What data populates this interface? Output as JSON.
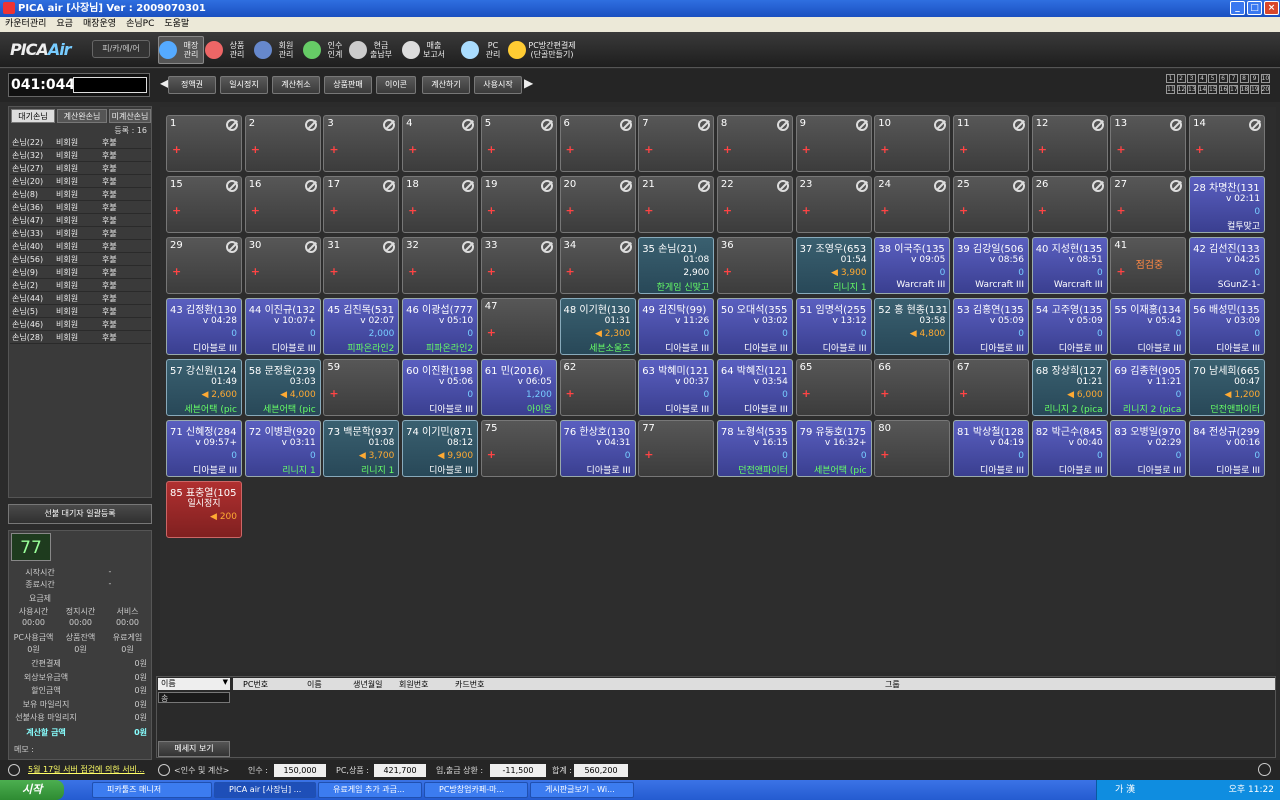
{
  "window": {
    "title": "PICA air [사장님]  Ver : 2009070301"
  },
  "menu": [
    "카운터관리",
    "요금",
    "매장운영",
    "손님PC",
    "도움말"
  ],
  "toolbar": {
    "logo_main": "PICA",
    "logo_air": "Air",
    "mode_label": "피/카/에/어",
    "items": [
      {
        "label": "매장\n관리",
        "icon": "monitor-icon",
        "color": "#5af"
      },
      {
        "label": "상품\n관리",
        "icon": "cart-icon",
        "color": "#e66"
      },
      {
        "label": "회원\n관리",
        "icon": "globe-icon",
        "color": "#68c"
      },
      {
        "label": "인수\n인계",
        "icon": "clock-icon",
        "color": "#6c6"
      },
      {
        "label": "현금\n출납부",
        "icon": "cashbox-icon",
        "color": "#ccc"
      },
      {
        "label": "매출\n보고서",
        "icon": "report-icon",
        "color": "#ddd"
      },
      {
        "label": "PC\n관리",
        "icon": "pc-icon",
        "color": "#adf"
      },
      {
        "label": "PC방간편결제\n(단골만들기)",
        "icon": "crown-icon",
        "color": "#fc3"
      }
    ]
  },
  "counter": {
    "value": "041:044"
  },
  "controls": [
    "정액권",
    "일시정지",
    "계산취소",
    "상품판매",
    "이이콘",
    "계산하기",
    "사용시작"
  ],
  "pages": [
    "1",
    "2",
    "3",
    "4",
    "5",
    "6",
    "7",
    "8",
    "9",
    "10",
    "11",
    "12",
    "13",
    "14",
    "15",
    "16",
    "17",
    "18",
    "19",
    "20"
  ],
  "left": {
    "tabs": [
      "대기손님",
      "계산완손님",
      "미계산손님"
    ],
    "count_label": "등록 : 16",
    "rows": [
      [
        "손님(22)",
        "비회원",
        "후불"
      ],
      [
        "손님(32)",
        "비회원",
        "후불"
      ],
      [
        "손님(27)",
        "비회원",
        "후불"
      ],
      [
        "손님(20)",
        "비회원",
        "후불"
      ],
      [
        "손님(8)",
        "비회원",
        "후불"
      ],
      [
        "손님(36)",
        "비회원",
        "후불"
      ],
      [
        "손님(47)",
        "비회원",
        "후불"
      ],
      [
        "손님(33)",
        "비회원",
        "후불"
      ],
      [
        "손님(40)",
        "비회원",
        "후불"
      ],
      [
        "손님(56)",
        "비회원",
        "후불"
      ],
      [
        "손님(9)",
        "비회원",
        "후불"
      ],
      [
        "손님(2)",
        "비회원",
        "후불"
      ],
      [
        "손님(44)",
        "비회원",
        "후불"
      ],
      [
        "손님(5)",
        "비회원",
        "후불"
      ],
      [
        "손님(46)",
        "비회원",
        "후불"
      ],
      [
        "손님(28)",
        "비회원",
        "후불"
      ]
    ]
  },
  "register_button": "선불 대기자 일괄등록",
  "info": {
    "seat": "77",
    "start_label": "시작시간",
    "start_val": "-",
    "end_label": "종료시간",
    "end_val": "-",
    "fee_label": "요금제",
    "use_label": "사용시간",
    "stop_label": "정지시간",
    "service_label": "서비스",
    "use_val": "00:00",
    "stop_val": "00:00",
    "service_val": "00:00",
    "pcamt_label": "PC사용금액",
    "goods_label": "상품잔액",
    "paid_label": "유료게임",
    "pcamt_val": "0원",
    "goods_val": "0원",
    "paid_val": "0원",
    "rows": [
      [
        "간편결제",
        "0원"
      ],
      [
        "외상보유금액",
        "0원"
      ],
      [
        "할인금액",
        "0원"
      ],
      [
        "보유 마일리지",
        "0원"
      ],
      [
        "선불사용 마일리지",
        "0원"
      ]
    ],
    "total_label": "계산할 금액",
    "total_val": "0원",
    "memo_label": "메모 :"
  },
  "seats": [
    {
      "n": "1",
      "s": "empty"
    },
    {
      "n": "2",
      "s": "empty"
    },
    {
      "n": "3",
      "s": "empty"
    },
    {
      "n": "4",
      "s": "empty"
    },
    {
      "n": "5",
      "s": "empty"
    },
    {
      "n": "6",
      "s": "empty"
    },
    {
      "n": "7",
      "s": "empty"
    },
    {
      "n": "8",
      "s": "empty"
    },
    {
      "n": "9",
      "s": "empty"
    },
    {
      "n": "10",
      "s": "empty"
    },
    {
      "n": "11",
      "s": "empty"
    },
    {
      "n": "12",
      "s": "empty"
    },
    {
      "n": "13",
      "s": "empty"
    },
    {
      "n": "14",
      "s": "empty"
    },
    {
      "n": "15",
      "s": "empty"
    },
    {
      "n": "16",
      "s": "empty"
    },
    {
      "n": "17",
      "s": "empty"
    },
    {
      "n": "18",
      "s": "empty"
    },
    {
      "n": "19",
      "s": "empty"
    },
    {
      "n": "20",
      "s": "empty"
    },
    {
      "n": "21",
      "s": "empty"
    },
    {
      "n": "22",
      "s": "empty"
    },
    {
      "n": "23",
      "s": "empty"
    },
    {
      "n": "24",
      "s": "empty"
    },
    {
      "n": "25",
      "s": "empty"
    },
    {
      "n": "26",
      "s": "empty"
    },
    {
      "n": "27",
      "s": "empty"
    },
    {
      "n": "28 차명찬(131",
      "s": "act",
      "t": "v 02:11",
      "m": "0",
      "g": "컬투맞고"
    },
    {
      "n": "29",
      "s": "empty"
    },
    {
      "n": "30",
      "s": "empty"
    },
    {
      "n": "31",
      "s": "empty"
    },
    {
      "n": "32",
      "s": "empty"
    },
    {
      "n": "33",
      "s": "empty"
    },
    {
      "n": "34",
      "s": "empty"
    },
    {
      "n": "35    손님(21)",
      "s": "teal",
      "t": "01:08",
      "m": "2,900",
      "mc": "w",
      "g": "한게임 신맞고",
      "gc": "gr"
    },
    {
      "n": "36",
      "s": "empty2"
    },
    {
      "n": "37 조영우(653",
      "s": "teal",
      "t": "01:54",
      "m": "◀ 3,900",
      "mc": "o",
      "g": "리니지 1",
      "gc": "gr"
    },
    {
      "n": "38 이국주(135",
      "s": "act",
      "t": "v 09:05",
      "m": "0",
      "g": "Warcraft III"
    },
    {
      "n": "39 김강일(506",
      "s": "act",
      "t": "v 08:56",
      "m": "0",
      "g": "Warcraft III"
    },
    {
      "n": "40 지성현(135",
      "s": "act",
      "t": "v 08:51",
      "m": "0",
      "g": "Warcraft III"
    },
    {
      "n": "41",
      "s": "check",
      "st": "점검중"
    },
    {
      "n": "42 김선진(133",
      "s": "act",
      "t": "v 04:25",
      "m": "0",
      "g": "SGunZ-1-"
    },
    {
      "n": "43 김정환(130",
      "s": "act",
      "t": "v 04:28",
      "m": "0",
      "g": "디아블로 III"
    },
    {
      "n": "44 이진규(132",
      "s": "act",
      "t": "v 10:07+",
      "m": "0",
      "g": "디아블로 III"
    },
    {
      "n": "45 김진목(531",
      "s": "act",
      "t": "v 02:07",
      "m": "2,000",
      "g": "피파온라인2",
      "gc": "gr"
    },
    {
      "n": "46 이광섭(777",
      "s": "act",
      "t": "v 05:10",
      "m": "0",
      "g": "피파온라인2",
      "gc": "gr"
    },
    {
      "n": "47",
      "s": "empty2"
    },
    {
      "n": "48 이기현(130",
      "s": "teal",
      "t": "01:31",
      "m": "◀ 2,300",
      "mc": "o",
      "g": "세븐소울즈",
      "gc": "gr"
    },
    {
      "n": "49 김진탁(99)",
      "s": "act",
      "t": "v 11:26",
      "m": "0",
      "g": "디아블로 III"
    },
    {
      "n": "50 오대석(355",
      "s": "act",
      "t": "v 03:02",
      "m": "0",
      "g": "디아블로 III"
    },
    {
      "n": "51 임명석(255",
      "s": "act",
      "t": "v 13:12",
      "m": "0",
      "g": "디아블로 III"
    },
    {
      "n": "52 홍 현종(131",
      "s": "teal",
      "t": "03:58",
      "m": "◀ 4,800",
      "mc": "o",
      "g": ""
    },
    {
      "n": "53 김홍연(135",
      "s": "act",
      "t": "v 05:09",
      "m": "0",
      "g": "디아블로 III"
    },
    {
      "n": "54 고주영(135",
      "s": "act",
      "t": "v 05:09",
      "m": "0",
      "g": "디아블로 III"
    },
    {
      "n": "55 이재홍(134",
      "s": "act",
      "t": "v 05:43",
      "m": "0",
      "g": "디아블로 III"
    },
    {
      "n": "56 배성민(135",
      "s": "act",
      "t": "v 03:09",
      "m": "0",
      "g": "디아블로 III"
    },
    {
      "n": "57 강신원(124",
      "s": "teal",
      "t": "01:49",
      "m": "◀ 2,600",
      "mc": "o",
      "g": "세븐어택 (pic",
      "gc": "gr"
    },
    {
      "n": "58 문정윤(239",
      "s": "teal",
      "t": "03:03",
      "m": "◀ 4,000",
      "mc": "o",
      "g": "세븐어택 (pic",
      "gc": "gr"
    },
    {
      "n": "59",
      "s": "empty2"
    },
    {
      "n": "60 이진환(198",
      "s": "act",
      "t": "v 05:06",
      "m": "0",
      "g": "디아블로 III"
    },
    {
      "n": "61    민(2016)",
      "s": "act",
      "t": "v 06:05",
      "m": "1,200",
      "g": "아이온",
      "gc": "gr"
    },
    {
      "n": "62",
      "s": "empty2"
    },
    {
      "n": "63 박혜미(121",
      "s": "act",
      "t": "v 00:37",
      "m": "0",
      "g": "디아블로 III"
    },
    {
      "n": "64 박혜진(121",
      "s": "act",
      "t": "v 03:54",
      "m": "0",
      "g": "디아블로 III"
    },
    {
      "n": "65",
      "s": "empty2"
    },
    {
      "n": "66",
      "s": "empty2"
    },
    {
      "n": "67",
      "s": "empty2"
    },
    {
      "n": "68 장상희(127",
      "s": "teal",
      "t": "01:21",
      "m": "◀ 6,000",
      "mc": "o",
      "g": "리니지 2 (pica",
      "gc": "gr"
    },
    {
      "n": "69 김종현(905",
      "s": "act",
      "t": "v 11:21",
      "m": "0",
      "g": "리니지 2 (pica",
      "gc": "gr"
    },
    {
      "n": "70 남세희(665",
      "s": "teal",
      "t": "00:47",
      "m": "◀ 1,200",
      "mc": "o",
      "g": "던전앤파이터",
      "gc": "gr"
    },
    {
      "n": "71 신혜정(284",
      "s": "act",
      "t": "v 09:57+",
      "m": "0",
      "g": "디아블로 III"
    },
    {
      "n": "72 이병관(920",
      "s": "act",
      "t": "v 03:11",
      "m": "0",
      "g": "리니지 1",
      "gc": "gr"
    },
    {
      "n": "73 백문학(937",
      "s": "teal",
      "t": "01:08",
      "m": "◀ 3,700",
      "mc": "o",
      "g": "리니지 1",
      "gc": "gr"
    },
    {
      "n": "74 이기민(871",
      "s": "teal",
      "t": "08:12",
      "m": "◀ 9,900",
      "mc": "o",
      "g": "디아블로 III"
    },
    {
      "n": "75",
      "s": "empty2"
    },
    {
      "n": "76 한상호(130",
      "s": "act",
      "t": "v 04:31",
      "m": "0",
      "g": "디아블로 III"
    },
    {
      "n": "77",
      "s": "empty2"
    },
    {
      "n": "78 노형석(535",
      "s": "act",
      "t": "v 16:15",
      "m": "0",
      "g": "던전앤파이터",
      "gc": "gr"
    },
    {
      "n": "79 유동호(175",
      "s": "act",
      "t": "v 16:32+",
      "m": "0",
      "g": "세븐어택 (pic",
      "gc": "gr"
    },
    {
      "n": "80",
      "s": "empty2"
    },
    {
      "n": "81 박상철(128",
      "s": "act",
      "t": "v 04:19",
      "m": "0",
      "g": "디아블로 III"
    },
    {
      "n": "82 박근수(845",
      "s": "act",
      "t": "v 00:40",
      "m": "0",
      "g": "디아블로 III"
    },
    {
      "n": "83 오병일(970",
      "s": "act",
      "t": "v 02:29",
      "m": "0",
      "g": "디아블로 III"
    },
    {
      "n": "84 전상규(299",
      "s": "act",
      "t": "v 00:16",
      "m": "0",
      "g": "디아블로 III"
    },
    {
      "n": "85 표충열(105",
      "s": "red",
      "t": "일시정지",
      "m": "◀ 200",
      "mc": "o",
      "g": ""
    }
  ],
  "bottom": {
    "name_select": "이름",
    "search_value": "송",
    "columns": [
      "PC번호",
      "이름",
      "생년월일",
      "회원번호",
      "카드번호",
      "그룹"
    ],
    "message_button": "메세지 보기"
  },
  "status": {
    "notice": "5월 17일 서버 점검에 의한 서비...",
    "handover": "<인수 및 계산>",
    "insu_label": "인수 :",
    "insu_val": "150,000",
    "pc_label": "PC,상품 :",
    "pc_val": "421,700",
    "io_label": "입,출금 상환 :",
    "io_val": "-11,500",
    "sum_label": "합계 :",
    "sum_val": "560,200"
  },
  "taskbar": {
    "start": "시작",
    "tasks": [
      "피카툴즈 매니저",
      "PICA air [사장님] ...",
      "유료게임 추가 과금...",
      "PC방창업카페-마...",
      "게시판글보기 - Wi..."
    ],
    "clock": "오후 11:22",
    "lang": "가 漢"
  }
}
